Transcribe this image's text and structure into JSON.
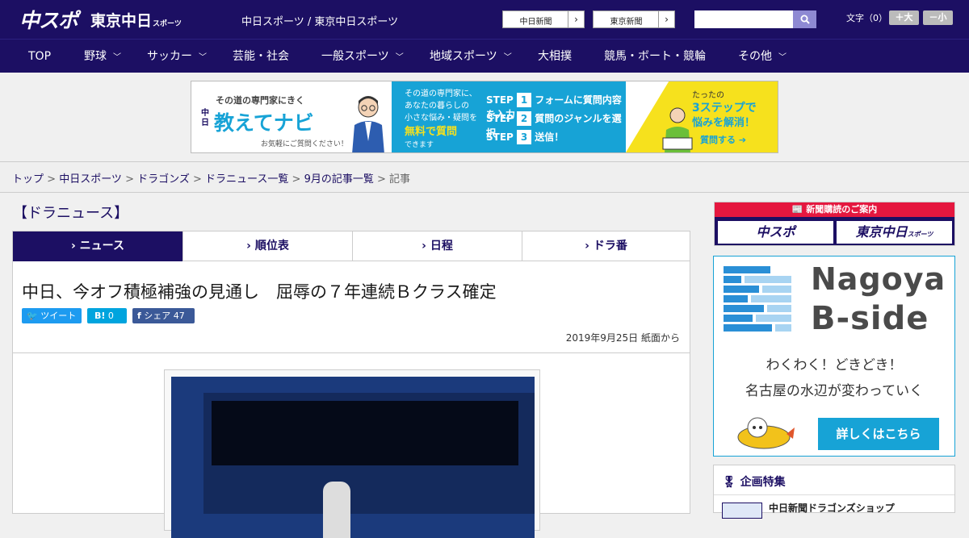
{
  "header": {
    "logo_chuspo": "中スポ",
    "logo_tokyo": "東京中日",
    "logo_tokyo_sub": "スポーツ",
    "site_links": "中日スポーツ / 東京中日スポーツ",
    "btn_chunichi": "中日新聞",
    "btn_tokyo": "東京新聞",
    "font_size_label": "文字（0）",
    "font_plus": "＋大",
    "font_minus": "－小"
  },
  "nav": [
    "TOP",
    "野球",
    "サッカー",
    "芸能・社会",
    "一般スポーツ",
    "地域スポーツ",
    "大相撲",
    "競馬・ボート・競輪",
    "その他"
  ],
  "banner": {
    "tagline": "その道の専門家にきく",
    "brand_small": "中日",
    "brand": "教えてナビ",
    "note": "お気軽にご質問ください！",
    "desc1": "その道の専門家に、",
    "desc2": "あなたの暮らしの",
    "desc3": "小さな悩み・疑問を",
    "free": "無料で質問",
    "can": "できます",
    "step_label": "STEP",
    "step1": "フォームに質問内容を入力",
    "step2": "質問のジャンルを選択",
    "step3": "送信！",
    "just": "たったの",
    "three": "3ステップで",
    "solve": "悩みを解消！",
    "ask": "質問する"
  },
  "breadcrumb": [
    "トップ",
    "中日スポーツ",
    "ドラゴンズ",
    "ドラニュース一覧",
    "9月の記事一覧",
    "記事"
  ],
  "section_title": "【ドラニュース】",
  "tabs": [
    "ニュース",
    "順位表",
    "日程",
    "ドラ番"
  ],
  "article": {
    "title": "中日、今オフ積極補強の見通し　屈辱の７年連続Ｂクラス確定",
    "tweet": "ツイート",
    "hatena_count": "0",
    "share": "シェア",
    "share_count": "47",
    "date": "2019年9月25日 紙面から"
  },
  "sidebar": {
    "subscribe_header": "新聞購読のご案内",
    "sub_chuspo": "中スポ",
    "sub_tokyo": "東京中日",
    "sub_tokyo_small": "スポーツ",
    "nagoya_title1": "Nagoya",
    "nagoya_title2": "B-side",
    "nagoya_copy1": "わくわく！どきどき！",
    "nagoya_copy2": "名古屋の水辺が変わっていく",
    "nagoya_btn": "詳しくはこちら",
    "feature_header": "企画特集",
    "feature_item": "中日新聞ドラゴンズショップ"
  },
  "colors": {
    "navy": "#1c0f63",
    "red": "#e5173f",
    "cyan": "#17a3d6",
    "yellow": "#f6e11d"
  }
}
